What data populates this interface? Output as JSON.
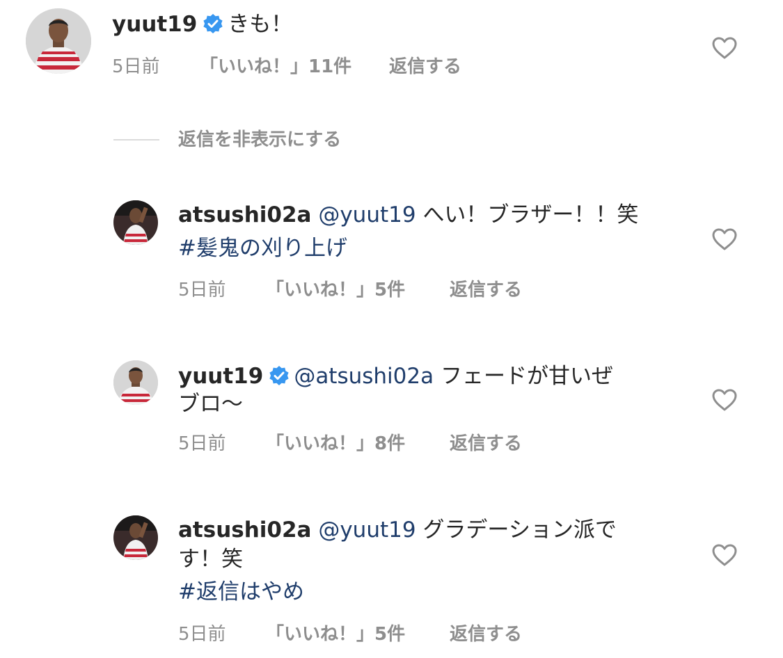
{
  "comments": [
    {
      "username": "yuut19",
      "verified": true,
      "mention": "",
      "text": "きも！",
      "text2": "",
      "hashtag": "",
      "time": "5日前",
      "likes": "「いいね！」11件",
      "reply": "返信する"
    },
    {
      "username": "atsushi02a",
      "verified": false,
      "mention": "@yuut19",
      "text": "へい！ブラザー！！笑",
      "text2": "",
      "hashtag": "#髪鬼の刈り上げ",
      "time": "5日前",
      "likes": "「いいね！」5件",
      "reply": "返信する"
    },
    {
      "username": "yuut19",
      "verified": true,
      "mention": "@atsushi02a",
      "text": "フェードが甘いぜ",
      "text2": "ブロ〜",
      "hashtag": "",
      "time": "5日前",
      "likes": "「いいね！」8件",
      "reply": "返信する"
    },
    {
      "username": "atsushi02a",
      "verified": false,
      "mention": "@yuut19",
      "text": "グラデーション派で",
      "text2": "す！笑",
      "hashtag": "#返信はやめ",
      "time": "5日前",
      "likes": "「いいね！」5件",
      "reply": "返信する"
    }
  ],
  "hide_replies": "返信を非表示にする",
  "icons": {
    "verified": "verified-badge-icon",
    "heart": "heart-outline-icon"
  },
  "colors": {
    "text": "#262626",
    "secondary": "#8e8e8e",
    "link": "#1f3d6b",
    "verified": "#3897f0"
  }
}
